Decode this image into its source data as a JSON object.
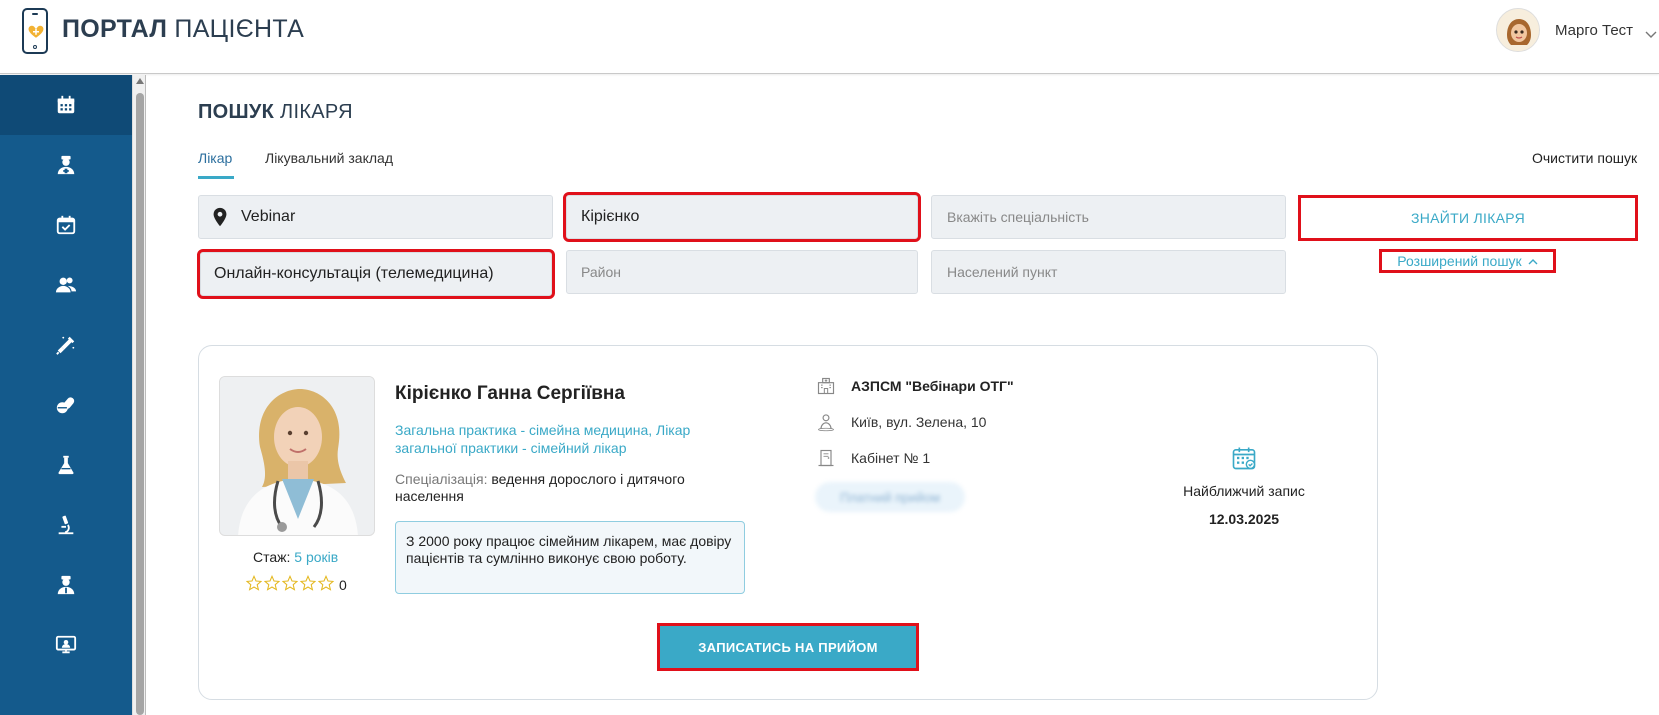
{
  "header": {
    "logo_bold": "ПОРТАЛ",
    "logo_rest": "ПАЦІЄНТА",
    "user_name": "Марго Тест"
  },
  "sidebar": {
    "items": [
      {
        "icon": "calendar-icon",
        "active": true
      },
      {
        "icon": "doctor-icon",
        "active": false
      },
      {
        "icon": "calendar-check-icon",
        "active": false
      },
      {
        "icon": "users-icon",
        "active": false
      },
      {
        "icon": "syringe-icon",
        "active": false
      },
      {
        "icon": "pills-icon",
        "active": false
      },
      {
        "icon": "flask-icon",
        "active": false
      },
      {
        "icon": "microscope-icon",
        "active": false
      },
      {
        "icon": "nurse-icon",
        "active": false
      },
      {
        "icon": "telemedicine-icon",
        "active": false
      }
    ]
  },
  "page": {
    "title_bold": "ПОШУК",
    "title_rest": "ЛІКАРЯ",
    "tabs": [
      {
        "label": "Лікар",
        "active": true
      },
      {
        "label": "Лікувальний заклад",
        "active": false
      }
    ],
    "clear_label": "Очистити пошук"
  },
  "search": {
    "location_value": "Vebinar",
    "name_value": "Кірієнко",
    "specialty_placeholder": "Вкажіть спеціальність",
    "consult_type_value": "Онлайн-консультація (телемедицина)",
    "district_placeholder": "Район",
    "settlement_placeholder": "Населений пункт",
    "find_label": "ЗНАЙТИ ЛІКАРЯ",
    "advanced_label": "Розширений пошук"
  },
  "doctor": {
    "name": "Кірієнко Ганна Сергіївна",
    "specialties": "Загальна практика - сімейна медицина, Лікар загальної практики - сімейний лікар",
    "specialization_label": "Спеціалізація:",
    "specialization_value": "ведення дорослого і дитячого населення",
    "about": "З 2000 року працює сімейним лікарем, має довіру пацієнтів та сумлінно виконує свою роботу.",
    "experience_label": "Стаж:",
    "experience_value": "5 років",
    "rating": "0",
    "facility": "АЗПСМ \"Вебінари ОТГ\"",
    "address": "Київ, вул. Зелена, 10",
    "cabinet": "Кабінет № 1",
    "blurred_button": "Платний прийом",
    "nearest_label": "Найближчий запис",
    "nearest_date": "12.03.2025",
    "book_label": "ЗАПИСАТИСЬ НА ПРИЙОМ"
  },
  "colors": {
    "sidebar": "#145a8c",
    "accent": "#3aa9c7",
    "highlight": "#e0101a"
  }
}
